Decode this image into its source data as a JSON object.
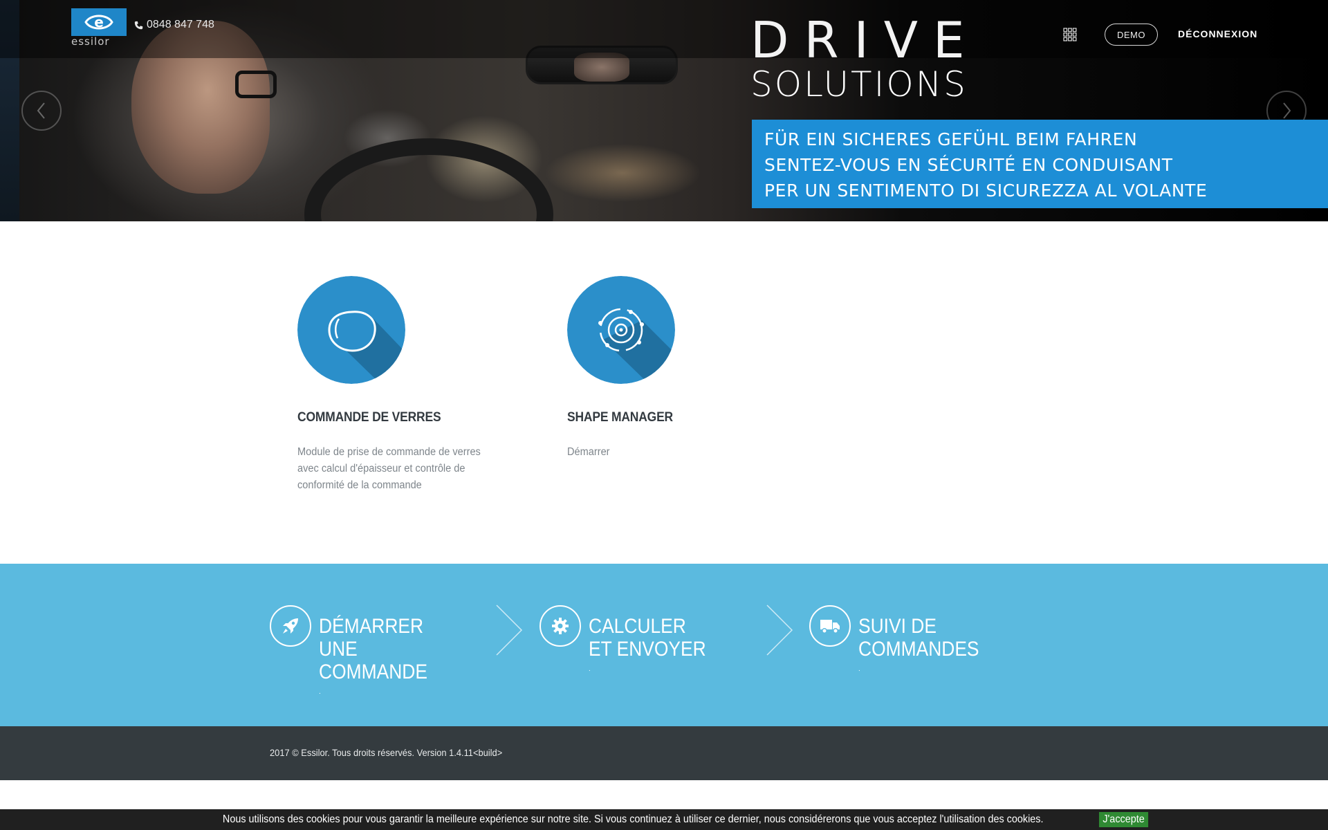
{
  "header": {
    "logo_text": "essilor",
    "phone": "0848 847 748",
    "demo_label": "DEMO",
    "logout_label": "DÉCONNEXION"
  },
  "hero": {
    "title_line1": "DRIVE",
    "title_line2": "SOLUTIONS",
    "taglines": [
      "FÜR EIN SICHERES GEFÜHL BEIM FAHREN",
      "SENTEZ-VOUS EN SÉCURITÉ EN CONDUISANT",
      "PER UN SENTIMENTO DI SICUREZZA AL VOLANTE"
    ]
  },
  "modules": [
    {
      "title": "COMMANDE DE VERRES",
      "description": "Module de prise de commande de verres avec calcul d'épaisseur et contrôle de conformité de la commande",
      "icon": "lens-icon"
    },
    {
      "title": "SHAPE MANAGER",
      "description": "Démarrer",
      "icon": "shape-scan-icon"
    }
  ],
  "steps": [
    {
      "label": "DÉMARRER UNE COMMANDE",
      "dot": ".",
      "icon": "rocket-icon"
    },
    {
      "label": "CALCULER ET ENVOYER",
      "dot": ".",
      "icon": "gear-icon"
    },
    {
      "label": "SUIVI DE COMMANDES",
      "dot": ".",
      "icon": "truck-icon"
    }
  ],
  "footer": {
    "text": "2017 © Essilor. Tous droits réservés. Version 1.4.11<build>"
  },
  "cookie": {
    "text": "Nous utilisons des cookies pour vous garantir la meilleure expérience sur notre site. Si vous continuez à utiliser ce dernier, nous considérerons que vous acceptez l'utilisation des cookies.",
    "accept_label": "J'accepte"
  },
  "colors": {
    "brand_blue": "#1d8ed6",
    "step_band": "#5bbadf",
    "footer_bg": "#343b3f",
    "module_icon": "#2b8fca",
    "cookie_accept": "#2f8a33"
  }
}
